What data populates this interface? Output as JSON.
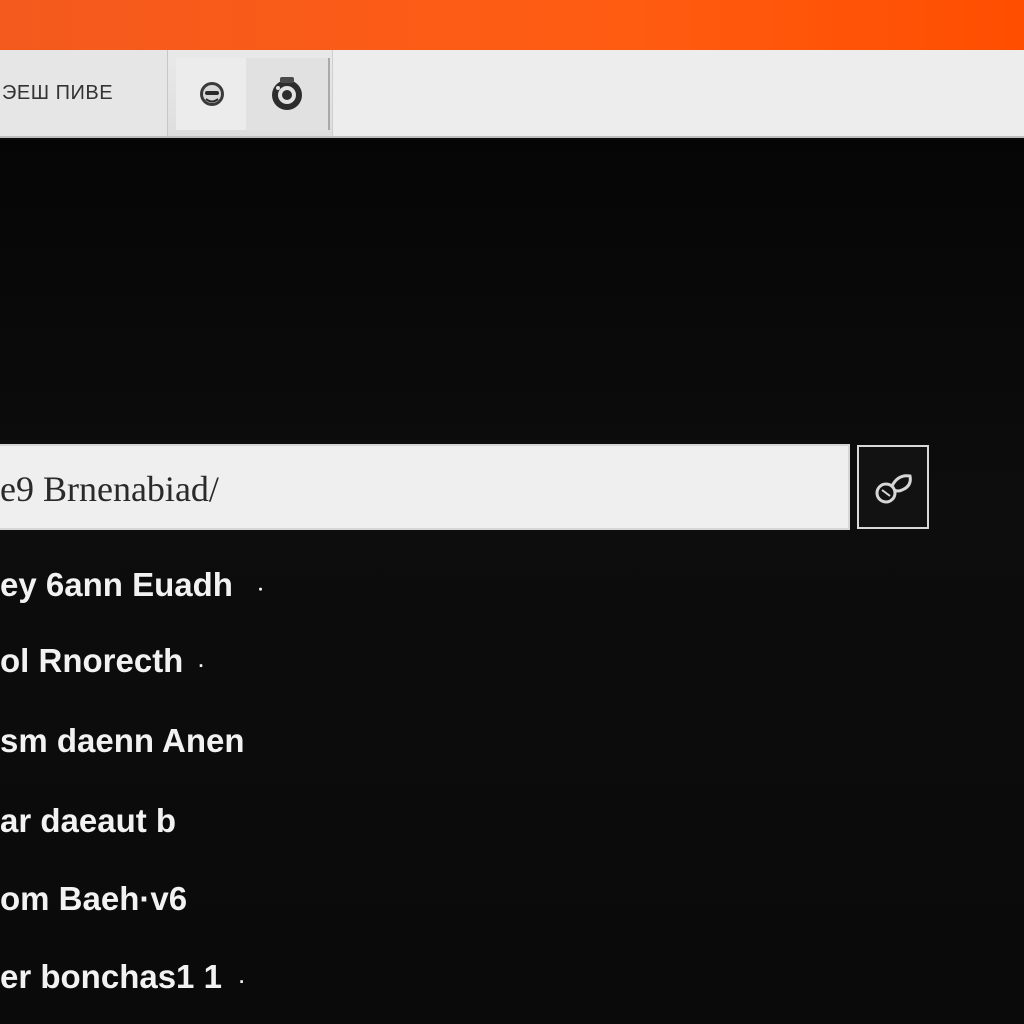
{
  "window": {
    "accent_color": "#ff5a14",
    "tab_title": "ЭЕШ ПИВЕ"
  },
  "toolbar": {
    "button_one_icon": "face-icon",
    "button_two_icon": "camera-icon"
  },
  "search": {
    "value": "e9 Brnenabiad/",
    "button_icon": "search-icon"
  },
  "results": [
    {
      "label": "ey 6ann Euadh",
      "suffix": "ㆍ"
    },
    {
      "label": "ol Rnorecth",
      "suffix": "·"
    },
    {
      "label": "sm daenn Anen",
      "suffix": ""
    },
    {
      "label": "ar daeaut b",
      "suffix": ""
    },
    {
      "label": "om Baeh·v6",
      "suffix": ""
    },
    {
      "label": "er bonchas1 1",
      "suffix": "·"
    }
  ]
}
